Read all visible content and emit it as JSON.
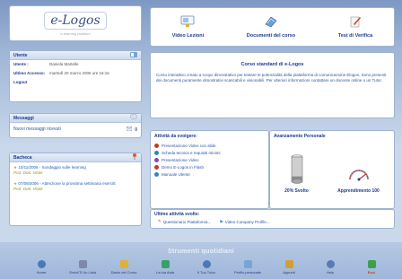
{
  "logo": {
    "title": "e-Logos",
    "tagline": "e-learning platform"
  },
  "utente": {
    "header": "Utente",
    "utente_label": "Utente :",
    "utente_value": "Daniela Martelle",
    "ultimo_label": "Ultimo Accesso:",
    "ultimo_value": "martedì 20 marzo 2006 ore 16:16",
    "logout": "Logout"
  },
  "messaggi": {
    "header": "Messaggi",
    "nuovi_label": "Nuovi messaggi ricevuti",
    "count": "0"
  },
  "bacheca": {
    "header": "Bacheca",
    "items": [
      {
        "text": "10/11/2006 - Sondaggio sulle learning",
        "author": "Prof. Dott. Vitale"
      },
      {
        "text": "07/09/2006 - Attenzione la prossima settimana esercitt",
        "author": "Prof. Dott. Vitale"
      }
    ]
  },
  "nav": {
    "video": "Video Lezioni",
    "documenti": "Documenti del corso",
    "test": "Test di Verifica"
  },
  "corso": {
    "title": "Corso standard di e-Logos",
    "desc": "Corso interattivo creato a scopo dimostrativo per testare le potenzialità della piattaforma di comunicazione Elogos. Sono presenti dei documenti puramente dimostrativi scaricabili e visionabili. Per ulteriori informazioni contattare un docente online o un Tutor."
  },
  "attivita": {
    "title": "Attività da svolgere:",
    "items": [
      {
        "label": "Presentazione Video con slide",
        "color": "#c0392b"
      },
      {
        "label": "Scheda tecnica e requisiti minimi",
        "color": "#2e86c1"
      },
      {
        "label": "Presentazione Video",
        "color": "#8e44ad"
      },
      {
        "label": "Demo E-Logos in Flash",
        "color": "#c0392b"
      },
      {
        "label": "Manuale Utente",
        "color": "#2e86c1"
      }
    ]
  },
  "avanzamento": {
    "title": "Avanzamento Personale",
    "svolto_label": "20% Svolto",
    "svolto_value": 20,
    "apprend_label": "Apprendimento 100",
    "apprend_value": 100
  },
  "altre": {
    "title": "Ultime attività svolte:",
    "items": [
      "Questionario Piattaforma...",
      "Video Company Profile..."
    ]
  },
  "strumenti": {
    "title": "Strumenti quotidiani"
  },
  "toolbar": [
    {
      "label": "Home",
      "icon": "home-icon",
      "color": "#4a79b8"
    },
    {
      "label": "Scrivi/Ti Un Lista",
      "icon": "people-icon",
      "color": "#7a8aa8"
    },
    {
      "label": "Diario del Corso",
      "icon": "folder-icon",
      "color": "#e0b03a"
    },
    {
      "label": "La tua Aula",
      "icon": "classroom-icon",
      "color": "#3a9f6a"
    },
    {
      "label": "Il Tuo Tutor",
      "icon": "tutor-icon",
      "color": "#4a79b8"
    },
    {
      "label": "Profilo personale",
      "icon": "profile-icon",
      "color": "#7aa3d8"
    },
    {
      "label": "Appunti",
      "icon": "pencil-icon",
      "color": "#d0a030"
    },
    {
      "label": "Help",
      "icon": "help-icon",
      "color": "#5a7ab8"
    },
    {
      "label": "Esci",
      "icon": "exit-icon",
      "color": "#3aa04a"
    }
  ]
}
